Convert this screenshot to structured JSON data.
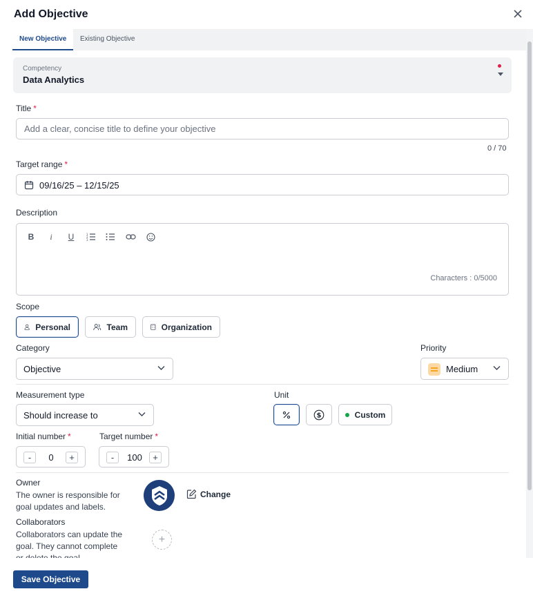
{
  "modal": {
    "title": "Add Objective"
  },
  "tabs": [
    {
      "label": "New Objective",
      "active": true
    },
    {
      "label": "Existing Objective",
      "active": false
    }
  ],
  "competency": {
    "label": "Competency",
    "value": "Data Analytics"
  },
  "title_field": {
    "label": "Title",
    "placeholder": "Add a clear, concise title to define your objective",
    "value": "",
    "counter": "0 / 70"
  },
  "target_range": {
    "label": "Target range",
    "value": "09/16/25 – 12/15/25"
  },
  "description": {
    "label": "Description",
    "toolbar": [
      "bold-icon",
      "italic-icon",
      "underline-icon",
      "ordered-list-icon",
      "bullet-list-icon",
      "link-icon",
      "emoji-icon"
    ],
    "counter": "Characters : 0/5000"
  },
  "scope": {
    "label": "Scope",
    "options": [
      {
        "label": "Personal",
        "selected": true
      },
      {
        "label": "Team",
        "selected": false
      },
      {
        "label": "Organization",
        "selected": false
      }
    ]
  },
  "category": {
    "label": "Category",
    "value": "Objective"
  },
  "priority": {
    "label": "Priority",
    "value": "Medium",
    "icon_color": "#f59e0b"
  },
  "measurement": {
    "label": "Measurement type",
    "value": "Should increase to"
  },
  "unit": {
    "label": "Unit",
    "options": [
      {
        "name": "percent-icon",
        "selected": true
      },
      {
        "name": "dollar-icon",
        "selected": false
      },
      {
        "label": "Custom",
        "selected": false,
        "dot_color": "#16a34a"
      }
    ]
  },
  "initial_number": {
    "label": "Initial number",
    "value": "0",
    "minus": "-",
    "plus": "+"
  },
  "target_number": {
    "label": "Target number",
    "value": "100",
    "minus": "-",
    "plus": "+"
  },
  "owner": {
    "heading": "Owner",
    "description": "The owner is responsible for goal updates and labels.",
    "change_label": "Change"
  },
  "collaborators": {
    "heading": "Collaborators",
    "description": "Collaborators can update the goal. They cannot complete or delete the goal.",
    "add_symbol": "+"
  },
  "footer": {
    "save_label": "Save Objective"
  },
  "colors": {
    "accent": "#1e4a8c",
    "required": "#e11d48"
  }
}
